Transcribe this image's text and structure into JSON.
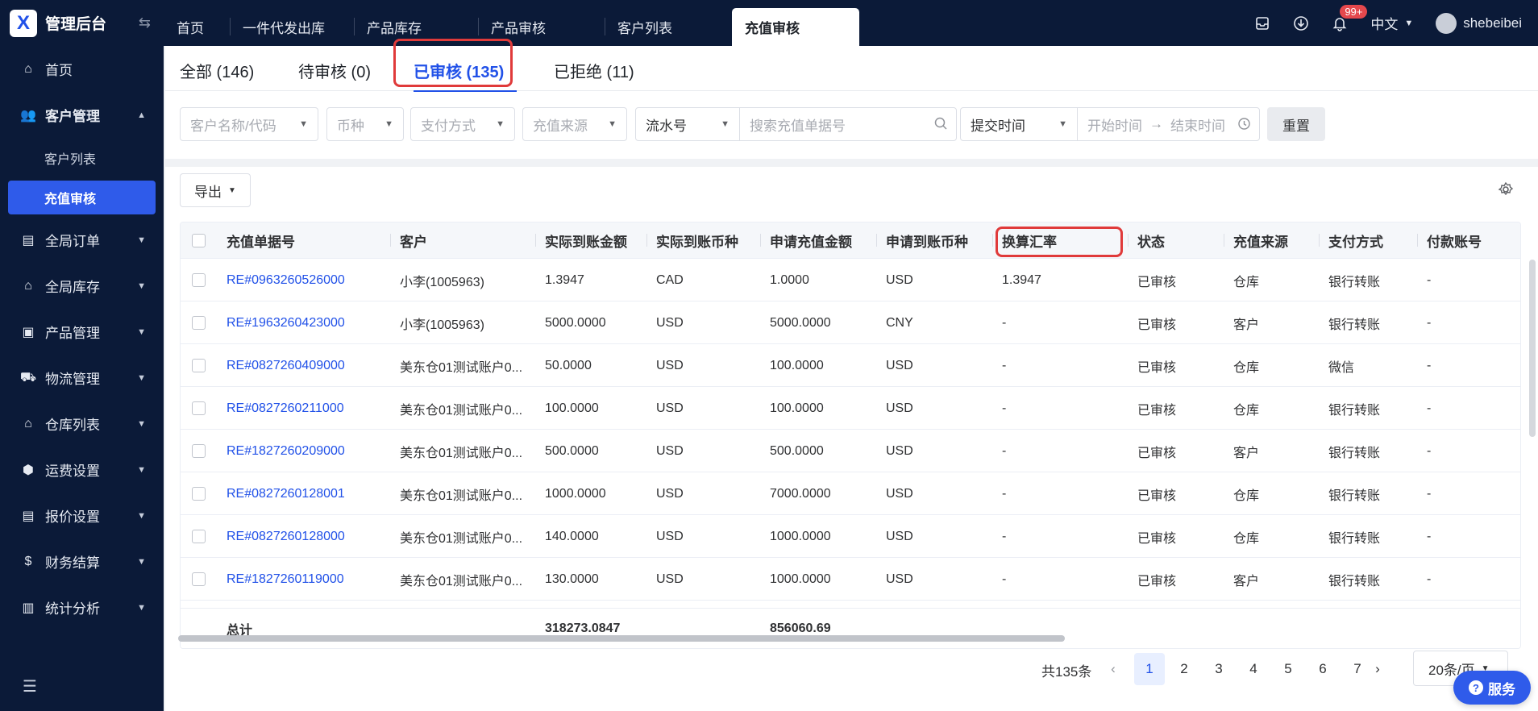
{
  "app": {
    "title": "管理后台",
    "logo_letter": "X"
  },
  "sidebar": {
    "items": [
      {
        "label": "首页",
        "icon": "home-icon"
      },
      {
        "label": "客户管理",
        "icon": "users-icon"
      },
      {
        "label": "全局订单",
        "icon": "order-icon"
      },
      {
        "label": "全局库存",
        "icon": "inventory-icon"
      },
      {
        "label": "产品管理",
        "icon": "product-icon"
      },
      {
        "label": "物流管理",
        "icon": "truck-icon"
      },
      {
        "label": "仓库列表",
        "icon": "warehouse-icon"
      },
      {
        "label": "运费设置",
        "icon": "freight-icon"
      },
      {
        "label": "报价设置",
        "icon": "quote-icon"
      },
      {
        "label": "财务结算",
        "icon": "finance-icon"
      },
      {
        "label": "统计分析",
        "icon": "chart-icon"
      }
    ],
    "sub_items": [
      {
        "label": "客户列表"
      },
      {
        "label": "充值审核"
      }
    ]
  },
  "topbar": {
    "tabs": [
      "首页",
      "一件代发出库",
      "产品库存",
      "产品审核",
      "客户列表",
      "充值审核"
    ],
    "notification_count": "99+",
    "language": "中文",
    "username": "shebeibei"
  },
  "status_tabs": [
    {
      "label": "全部 (146)"
    },
    {
      "label": "待审核 (0)"
    },
    {
      "label": "已审核 (135)"
    },
    {
      "label": "已拒绝 (11)"
    }
  ],
  "filters": {
    "customer_placeholder": "客户名称/代码",
    "currency_placeholder": "币种",
    "payment_placeholder": "支付方式",
    "source_placeholder": "充值来源",
    "serial_select": "流水号",
    "search_placeholder": "搜索充值单据号",
    "time_select": "提交时间",
    "start_placeholder": "开始时间",
    "arrow": "→",
    "end_placeholder": "结束时间",
    "reset_label": "重置"
  },
  "toolbar": {
    "export_label": "导出"
  },
  "table": {
    "columns": [
      "充值单据号",
      "客户",
      "实际到账金额",
      "实际到账币种",
      "申请充值金额",
      "申请到账币种",
      "换算汇率",
      "状态",
      "充值来源",
      "支付方式",
      "付款账号"
    ],
    "rows": [
      [
        "RE#0963260526000",
        "小李(1005963)",
        "1.3947",
        "CAD",
        "1.0000",
        "USD",
        "1.3947",
        "已审核",
        "仓库",
        "银行转账",
        "-"
      ],
      [
        "RE#1963260423000",
        "小李(1005963)",
        "5000.0000",
        "USD",
        "5000.0000",
        "CNY",
        "-",
        "已审核",
        "客户",
        "银行转账",
        "-"
      ],
      [
        "RE#0827260409000",
        "美东仓01测试账户0...",
        "50.0000",
        "USD",
        "100.0000",
        "USD",
        "-",
        "已审核",
        "仓库",
        "微信",
        "-"
      ],
      [
        "RE#0827260211000",
        "美东仓01测试账户0...",
        "100.0000",
        "USD",
        "100.0000",
        "USD",
        "-",
        "已审核",
        "仓库",
        "银行转账",
        "-"
      ],
      [
        "RE#1827260209000",
        "美东仓01测试账户0...",
        "500.0000",
        "USD",
        "500.0000",
        "USD",
        "-",
        "已审核",
        "客户",
        "银行转账",
        "-"
      ],
      [
        "RE#0827260128001",
        "美东仓01测试账户0...",
        "1000.0000",
        "USD",
        "7000.0000",
        "USD",
        "-",
        "已审核",
        "仓库",
        "银行转账",
        "-"
      ],
      [
        "RE#0827260128000",
        "美东仓01测试账户0...",
        "140.0000",
        "USD",
        "1000.0000",
        "USD",
        "-",
        "已审核",
        "仓库",
        "银行转账",
        "-"
      ],
      [
        "RE#1827260119000",
        "美东仓01测试账户0...",
        "130.0000",
        "USD",
        "1000.0000",
        "USD",
        "-",
        "已审核",
        "客户",
        "银行转账",
        "-"
      ]
    ],
    "total": {
      "label": "总计",
      "actual_amount": "318273.0847",
      "applied_amount": "856060.69"
    }
  },
  "pagination": {
    "total_label": "共135条",
    "pages": [
      "1",
      "2",
      "3",
      "4",
      "5",
      "6",
      "7"
    ],
    "current": "1",
    "page_size": "20条/页"
  },
  "service_label": "服务",
  "colors": {
    "sidebar_bg": "#0b1a38",
    "accent": "#2151e8",
    "highlight": "#e03a3a"
  }
}
